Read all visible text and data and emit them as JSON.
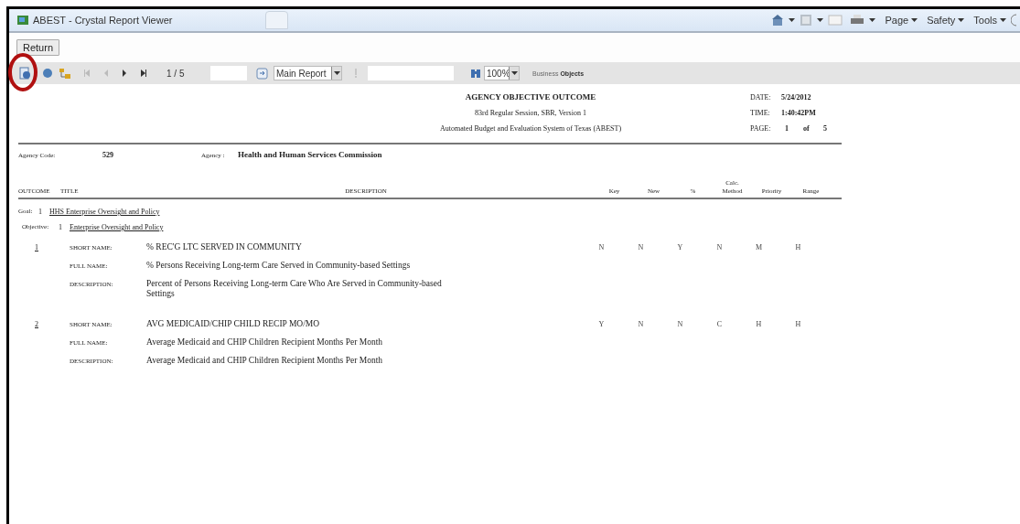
{
  "window": {
    "title": "ABEST - Crystal Report Viewer"
  },
  "browser_menu": [
    "Page",
    "Safety",
    "Tools"
  ],
  "return_button": "Return",
  "toolbar": {
    "page_indicator": "1 / 5",
    "report_select": "Main Report",
    "zoom_select": "100%",
    "logo": [
      "Business",
      "Objects"
    ]
  },
  "report": {
    "title": "AGENCY OBJECTIVE OUTCOME",
    "subtitles": [
      "83rd Regular Session, SBR, Version 1",
      "Automated Budget and Evaluation System of Texas (ABEST)"
    ],
    "meta": [
      {
        "label": "DATE:",
        "value": "5/24/2012"
      },
      {
        "label": "TIME:",
        "value": "1:40:42PM"
      }
    ],
    "page": {
      "label": "PAGE:",
      "current": "1",
      "of": "of",
      "total": "5"
    },
    "agency_code_label": "Agency Code:",
    "agency_code": "529",
    "agency_label": "Agency :",
    "agency": "Health and Human Services Commission",
    "columns": {
      "outcome": "OUTCOME",
      "title": "TITLE",
      "description": "DESCRIPTION",
      "flags": [
        [
          "Key"
        ],
        [
          "New"
        ],
        [
          "%"
        ],
        [
          "Calc.",
          "Method"
        ],
        [
          "Priority"
        ],
        [
          "Range"
        ]
      ]
    },
    "goal": {
      "label": "Goal:",
      "number": "1",
      "name": "HHS Enterprise Oversight and Policy"
    },
    "objective": {
      "label": "Objective:",
      "number": "1",
      "name": "Enterprise Oversight and Policy"
    },
    "outcomes": [
      {
        "number": "1",
        "fields": [
          {
            "label": "SHORT NAME:",
            "value": "% REC'G LTC SERVED IN COMMUNITY"
          },
          {
            "label": "FULL NAME:",
            "value": "% Persons Receiving Long-term Care Served in Community-based Settings"
          },
          {
            "label": "DESCRIPTION:",
            "value": "Percent of Persons Receiving Long-term Care Who Are Served in Community-based Settings"
          }
        ],
        "flags": [
          "N",
          "N",
          "Y",
          "N",
          "M",
          "H"
        ]
      },
      {
        "number": "2",
        "fields": [
          {
            "label": "SHORT NAME:",
            "value": "AVG MEDICAID/CHIP CHILD RECIP MO/MO"
          },
          {
            "label": "FULL NAME:",
            "value": "Average Medicaid and CHIP Children Recipient Months Per Month"
          },
          {
            "label": "DESCRIPTION:",
            "value": "Average Medicaid and CHIP Children Recipient Months Per Month"
          }
        ],
        "flags": [
          "Y",
          "N",
          "N",
          "C",
          "H",
          "H"
        ]
      }
    ]
  }
}
